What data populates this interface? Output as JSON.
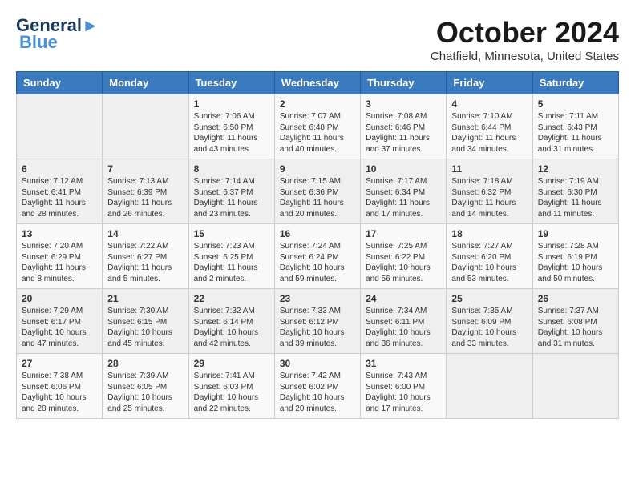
{
  "header": {
    "logo_line1": "General",
    "logo_line2": "Blue",
    "month_title": "October 2024",
    "location": "Chatfield, Minnesota, United States"
  },
  "days_of_week": [
    "Sunday",
    "Monday",
    "Tuesday",
    "Wednesday",
    "Thursday",
    "Friday",
    "Saturday"
  ],
  "weeks": [
    [
      {
        "day": "",
        "info": ""
      },
      {
        "day": "",
        "info": ""
      },
      {
        "day": "1",
        "info": "Sunrise: 7:06 AM\nSunset: 6:50 PM\nDaylight: 11 hours and 43 minutes."
      },
      {
        "day": "2",
        "info": "Sunrise: 7:07 AM\nSunset: 6:48 PM\nDaylight: 11 hours and 40 minutes."
      },
      {
        "day": "3",
        "info": "Sunrise: 7:08 AM\nSunset: 6:46 PM\nDaylight: 11 hours and 37 minutes."
      },
      {
        "day": "4",
        "info": "Sunrise: 7:10 AM\nSunset: 6:44 PM\nDaylight: 11 hours and 34 minutes."
      },
      {
        "day": "5",
        "info": "Sunrise: 7:11 AM\nSunset: 6:43 PM\nDaylight: 11 hours and 31 minutes."
      }
    ],
    [
      {
        "day": "6",
        "info": "Sunrise: 7:12 AM\nSunset: 6:41 PM\nDaylight: 11 hours and 28 minutes."
      },
      {
        "day": "7",
        "info": "Sunrise: 7:13 AM\nSunset: 6:39 PM\nDaylight: 11 hours and 26 minutes."
      },
      {
        "day": "8",
        "info": "Sunrise: 7:14 AM\nSunset: 6:37 PM\nDaylight: 11 hours and 23 minutes."
      },
      {
        "day": "9",
        "info": "Sunrise: 7:15 AM\nSunset: 6:36 PM\nDaylight: 11 hours and 20 minutes."
      },
      {
        "day": "10",
        "info": "Sunrise: 7:17 AM\nSunset: 6:34 PM\nDaylight: 11 hours and 17 minutes."
      },
      {
        "day": "11",
        "info": "Sunrise: 7:18 AM\nSunset: 6:32 PM\nDaylight: 11 hours and 14 minutes."
      },
      {
        "day": "12",
        "info": "Sunrise: 7:19 AM\nSunset: 6:30 PM\nDaylight: 11 hours and 11 minutes."
      }
    ],
    [
      {
        "day": "13",
        "info": "Sunrise: 7:20 AM\nSunset: 6:29 PM\nDaylight: 11 hours and 8 minutes."
      },
      {
        "day": "14",
        "info": "Sunrise: 7:22 AM\nSunset: 6:27 PM\nDaylight: 11 hours and 5 minutes."
      },
      {
        "day": "15",
        "info": "Sunrise: 7:23 AM\nSunset: 6:25 PM\nDaylight: 11 hours and 2 minutes."
      },
      {
        "day": "16",
        "info": "Sunrise: 7:24 AM\nSunset: 6:24 PM\nDaylight: 10 hours and 59 minutes."
      },
      {
        "day": "17",
        "info": "Sunrise: 7:25 AM\nSunset: 6:22 PM\nDaylight: 10 hours and 56 minutes."
      },
      {
        "day": "18",
        "info": "Sunrise: 7:27 AM\nSunset: 6:20 PM\nDaylight: 10 hours and 53 minutes."
      },
      {
        "day": "19",
        "info": "Sunrise: 7:28 AM\nSunset: 6:19 PM\nDaylight: 10 hours and 50 minutes."
      }
    ],
    [
      {
        "day": "20",
        "info": "Sunrise: 7:29 AM\nSunset: 6:17 PM\nDaylight: 10 hours and 47 minutes."
      },
      {
        "day": "21",
        "info": "Sunrise: 7:30 AM\nSunset: 6:15 PM\nDaylight: 10 hours and 45 minutes."
      },
      {
        "day": "22",
        "info": "Sunrise: 7:32 AM\nSunset: 6:14 PM\nDaylight: 10 hours and 42 minutes."
      },
      {
        "day": "23",
        "info": "Sunrise: 7:33 AM\nSunset: 6:12 PM\nDaylight: 10 hours and 39 minutes."
      },
      {
        "day": "24",
        "info": "Sunrise: 7:34 AM\nSunset: 6:11 PM\nDaylight: 10 hours and 36 minutes."
      },
      {
        "day": "25",
        "info": "Sunrise: 7:35 AM\nSunset: 6:09 PM\nDaylight: 10 hours and 33 minutes."
      },
      {
        "day": "26",
        "info": "Sunrise: 7:37 AM\nSunset: 6:08 PM\nDaylight: 10 hours and 31 minutes."
      }
    ],
    [
      {
        "day": "27",
        "info": "Sunrise: 7:38 AM\nSunset: 6:06 PM\nDaylight: 10 hours and 28 minutes."
      },
      {
        "day": "28",
        "info": "Sunrise: 7:39 AM\nSunset: 6:05 PM\nDaylight: 10 hours and 25 minutes."
      },
      {
        "day": "29",
        "info": "Sunrise: 7:41 AM\nSunset: 6:03 PM\nDaylight: 10 hours and 22 minutes."
      },
      {
        "day": "30",
        "info": "Sunrise: 7:42 AM\nSunset: 6:02 PM\nDaylight: 10 hours and 20 minutes."
      },
      {
        "day": "31",
        "info": "Sunrise: 7:43 AM\nSunset: 6:00 PM\nDaylight: 10 hours and 17 minutes."
      },
      {
        "day": "",
        "info": ""
      },
      {
        "day": "",
        "info": ""
      }
    ]
  ]
}
